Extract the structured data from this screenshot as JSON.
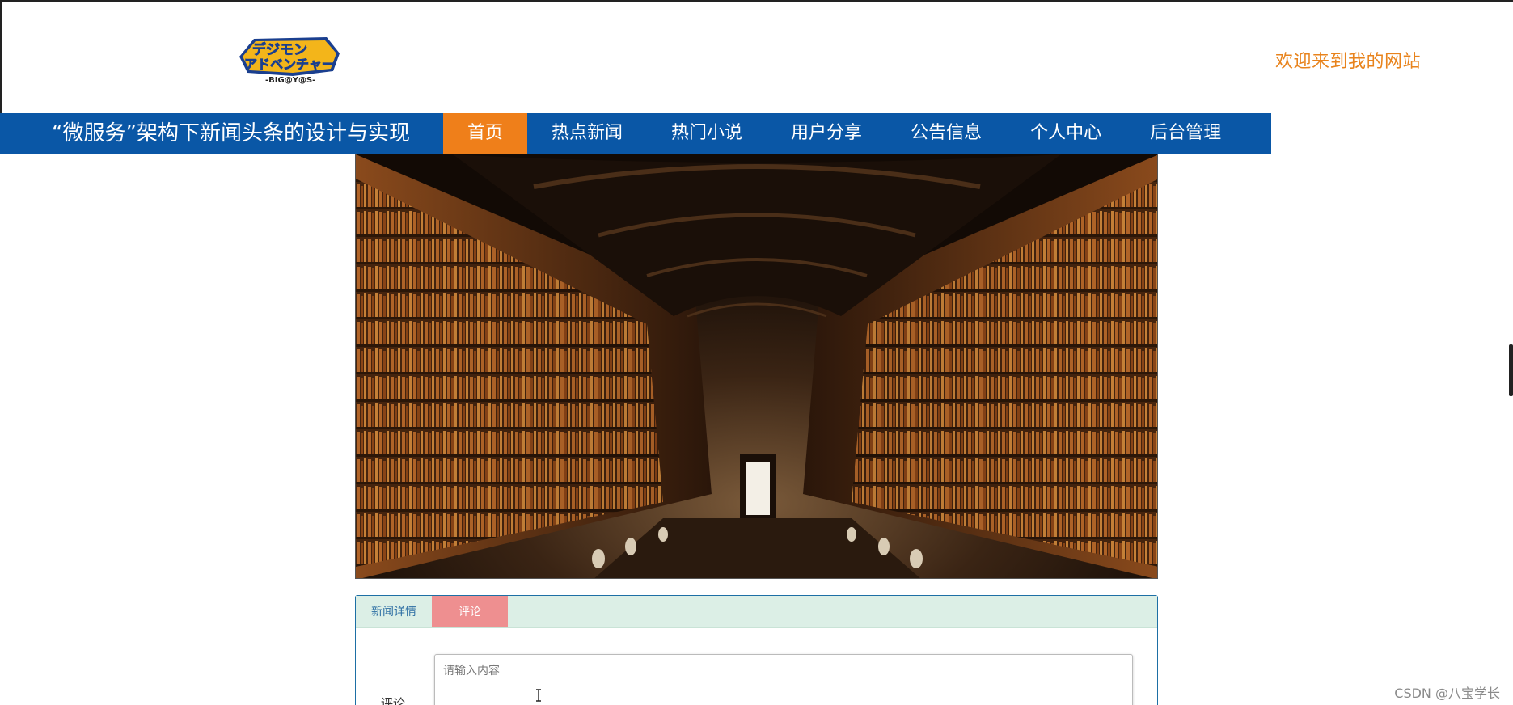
{
  "header": {
    "logo_icon": "digimon-adventure-logo-icon",
    "logo_text": "-BIG@Y@S-",
    "welcome_text": "欢迎来到我的网站"
  },
  "navbar": {
    "site_title": "“微服务”架构下新闻头条的设计与实现",
    "items": [
      {
        "label": "首页",
        "active": true
      },
      {
        "label": "热点新闻",
        "active": false
      },
      {
        "label": "热门小说",
        "active": false
      },
      {
        "label": "用户分享",
        "active": false
      },
      {
        "label": "公告信息",
        "active": false
      },
      {
        "label": "个人中心",
        "active": false
      },
      {
        "label": "后台管理",
        "active": false
      }
    ]
  },
  "banner": {
    "icon": "library-hall-banner-image"
  },
  "tabs": {
    "items": [
      {
        "label": "新闻详情",
        "active": false
      },
      {
        "label": "评论",
        "active": true
      }
    ]
  },
  "comment": {
    "label": "评论",
    "placeholder": "请输入内容",
    "value": ""
  },
  "watermark": "CSDN @八宝学长",
  "colors": {
    "nav_bg": "#0a57a6",
    "nav_active": "#ef7f1a",
    "welcome": "#e8831c",
    "tab_header_bg": "#dcefe6",
    "tab_active": "#ee8f90"
  }
}
